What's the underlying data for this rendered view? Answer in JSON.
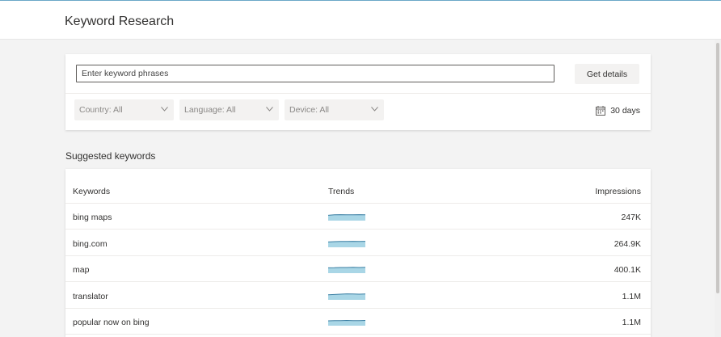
{
  "header": {
    "title": "Keyword Research"
  },
  "search": {
    "placeholder": "Enter keyword phrases",
    "button_label": "Get details"
  },
  "filters": [
    {
      "label": "Country: All"
    },
    {
      "label": "Language: All"
    },
    {
      "label": "Device: All"
    }
  ],
  "date_range": {
    "icon": "calendar-icon",
    "label": "30 days"
  },
  "suggested": {
    "title": "Suggested keywords",
    "columns": {
      "keyword": "Keywords",
      "trend": "Trends",
      "impressions": "Impressions"
    },
    "rows": [
      {
        "keyword": "bing maps",
        "impressions": "247K",
        "trend": [
          0.55,
          0.6,
          0.62,
          0.6,
          0.6,
          0.62,
          0.6
        ]
      },
      {
        "keyword": "bing.com",
        "impressions": "264.9K",
        "trend": [
          0.55,
          0.58,
          0.6,
          0.6,
          0.62,
          0.6,
          0.62
        ]
      },
      {
        "keyword": "map",
        "impressions": "400.1K",
        "trend": [
          0.55,
          0.56,
          0.58,
          0.58,
          0.6,
          0.58,
          0.6
        ]
      },
      {
        "keyword": "translator",
        "impressions": "1.1M",
        "trend": [
          0.52,
          0.55,
          0.58,
          0.62,
          0.6,
          0.58,
          0.6
        ]
      },
      {
        "keyword": "popular now on bing",
        "impressions": "1.1M",
        "trend": [
          0.5,
          0.52,
          0.52,
          0.54,
          0.52,
          0.52,
          0.54
        ]
      }
    ]
  },
  "colors": {
    "accent_line": "#6aa8c7",
    "spark_stroke": "#3a7fa3",
    "spark_fill": "#a9d6e6"
  }
}
